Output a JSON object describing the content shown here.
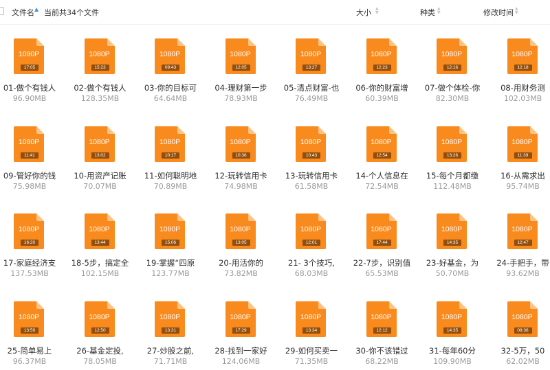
{
  "header": {
    "name_label": "文件名",
    "count_label": "当前共34个文件",
    "size_label": "大小",
    "kind_label": "种类",
    "mtime_label": "修改时间"
  },
  "colors": {
    "file_orange": "#f98a1d",
    "file_fold": "#fcc382",
    "accent": "#4a90e2"
  },
  "icons": {
    "sort": "sort-ascending-icon",
    "file": "video-file-icon"
  },
  "files": [
    {
      "name": "01-做个有钱人",
      "size": "96.90MB",
      "res": "1080P",
      "dur": "17:05"
    },
    {
      "name": "02-做个有钱人",
      "size": "128.35MB",
      "res": "1080P",
      "dur": "15:23"
    },
    {
      "name": "03-你的目标可",
      "size": "64.64MB",
      "res": "1080P",
      "dur": "09:43"
    },
    {
      "name": "04-理财第一步",
      "size": "78.93MB",
      "res": "1080P",
      "dur": "12:05"
    },
    {
      "name": "05-清点财富-也",
      "size": "76.49MB",
      "res": "1080P",
      "dur": "13:27"
    },
    {
      "name": "06-你的财富增",
      "size": "60.39MB",
      "res": "1080P",
      "dur": "12:23"
    },
    {
      "name": "07-做个体检-你",
      "size": "82.30MB",
      "res": "1080P",
      "dur": "12:16"
    },
    {
      "name": "08-用财务测",
      "size": "102.03MB",
      "res": "1080P",
      "dur": "12:18"
    },
    {
      "name": "09-管好你的钱",
      "size": "75.98MB",
      "res": "1080P",
      "dur": "11:41"
    },
    {
      "name": "10-用资产记账",
      "size": "70.07MB",
      "res": "1080P",
      "dur": "13:02"
    },
    {
      "name": "11-如何聪明地",
      "size": "70.89MB",
      "res": "1080P",
      "dur": "10:17"
    },
    {
      "name": "12-玩转信用卡",
      "size": "74.98MB",
      "res": "1080P",
      "dur": "10:36"
    },
    {
      "name": "13-玩转信用卡",
      "size": "61.58MB",
      "res": "1080P",
      "dur": "10:43"
    },
    {
      "name": "14-个人信息在",
      "size": "72.54MB",
      "res": "1080P",
      "dur": "12:54"
    },
    {
      "name": "15-每个月都缴",
      "size": "112.48MB",
      "res": "1080P",
      "dur": "13:26"
    },
    {
      "name": "16-从需求出",
      "size": "95.74MB",
      "res": "1080P",
      "dur": "11:39"
    },
    {
      "name": "17-家庭经济支",
      "size": "137.53MB",
      "res": "1080P",
      "dur": "16:20"
    },
    {
      "name": "18-5步，搞定全",
      "size": "102.15MB",
      "res": "1080P",
      "dur": "13:44"
    },
    {
      "name": "19-掌握“四原",
      "size": "123.77MB",
      "res": "1080P",
      "dur": "15:06"
    },
    {
      "name": "20-用活你的",
      "size": "73.82MB",
      "res": "1080P",
      "dur": "13:05"
    },
    {
      "name": "21- 3个技巧,",
      "size": "68.03MB",
      "res": "1080P",
      "dur": "12:01"
    },
    {
      "name": "22-7步，识别值",
      "size": "65.53MB",
      "res": "1080P",
      "dur": "17:44"
    },
    {
      "name": "23-好基金，为",
      "size": "50.70MB",
      "res": "1080P",
      "dur": "14:35"
    },
    {
      "name": "24-手把手，带",
      "size": "93.62MB",
      "res": "1080P",
      "dur": "12:47"
    },
    {
      "name": "25-简单易上",
      "size": "96.37MB",
      "res": "1080P",
      "dur": "13:59"
    },
    {
      "name": "26-基金定投,",
      "size": "78.05MB",
      "res": "1080P",
      "dur": "12:50"
    },
    {
      "name": "27-炒股之前,",
      "size": "71.71MB",
      "res": "1080P",
      "dur": "13:31"
    },
    {
      "name": "28-找到一家好",
      "size": "124.06MB",
      "res": "1080P",
      "dur": "17:29"
    },
    {
      "name": "29-如何买卖一",
      "size": "71.35MB",
      "res": "1080P",
      "dur": "13:34"
    },
    {
      "name": "30-你不该错过",
      "size": "68.22MB",
      "res": "1080P",
      "dur": "12:12"
    },
    {
      "name": "31-每年60分",
      "size": "109.90MB",
      "res": "1080P",
      "dur": "14:35"
    },
    {
      "name": "32-5万，50",
      "size": "62.02MB",
      "res": "1080P",
      "dur": "08:36"
    }
  ]
}
